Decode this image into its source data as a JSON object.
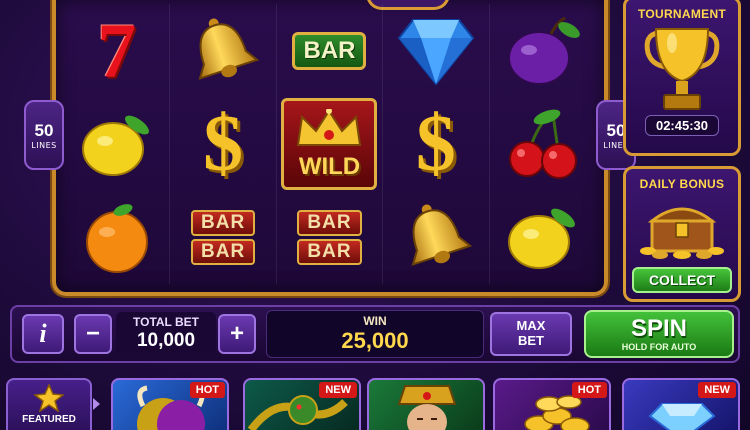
{
  "reels": {
    "lines_left": {
      "count": "50",
      "label": "LINES"
    },
    "lines_right": {
      "count": "50",
      "label": "LINES"
    },
    "grid": [
      [
        {
          "type": "seven",
          "text": "7"
        },
        {
          "type": "bell"
        },
        {
          "type": "bar",
          "text": "BAR"
        },
        {
          "type": "diamond"
        },
        {
          "type": "plum"
        }
      ],
      [
        {
          "type": "lemon"
        },
        {
          "type": "dollar",
          "text": "$"
        },
        {
          "type": "wild",
          "text": "WILD"
        },
        {
          "type": "dollar",
          "text": "$"
        },
        {
          "type": "cherries"
        }
      ],
      [
        {
          "type": "orange"
        },
        {
          "type": "bar2",
          "text": "BAR"
        },
        {
          "type": "bar2",
          "text": "BAR"
        },
        {
          "type": "bell"
        },
        {
          "type": "lemon"
        }
      ]
    ]
  },
  "tournament": {
    "title": "TOURNAMENT",
    "timer": "02:45:30",
    "icon": "trophy-icon"
  },
  "daily_bonus": {
    "title": "DAILY BONUS",
    "button": "COLLECT",
    "icon": "treasure-chest-icon"
  },
  "controls": {
    "info_label": "i",
    "minus_label": "−",
    "plus_label": "+",
    "total_bet_label": "TOTAL BET",
    "total_bet_value": "10,000",
    "win_label": "WIN",
    "win_value": "25,000",
    "max_bet_line1": "MAX",
    "max_bet_line2": "BET",
    "spin_label": "SPIN",
    "spin_sub": "HOLD FOR AUTO"
  },
  "games": {
    "featured_label": "FEATURED",
    "tiles": [
      {
        "badge": "HOT",
        "theme": "buffalo"
      },
      {
        "badge": "NEW",
        "theme": "dragon"
      },
      {
        "badge": "",
        "theme": "emperor"
      },
      {
        "badge": "HOT",
        "theme": "coins"
      },
      {
        "badge": "NEW",
        "theme": "diamond"
      }
    ]
  },
  "colors": {
    "accent_gold": "#d99b33",
    "spin_green": "#43c13a",
    "panel_purple": "#3d1670",
    "badge_red": "#d41818"
  }
}
